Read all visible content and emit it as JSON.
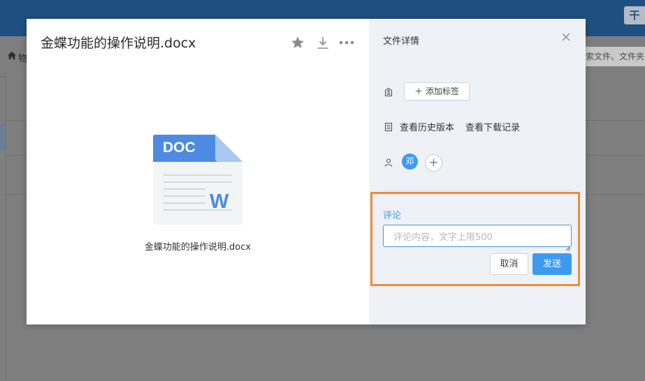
{
  "background": {
    "topbar_button": "干",
    "breadcrumb_text": "物",
    "search_placeholder": "索文件、文件夹"
  },
  "preview": {
    "file_name": "金蝶功能的操作说明.docx",
    "file_caption": "金蝶功能的操作说明.docx",
    "icon_type_text": "DOC",
    "icon_app_letter": "W",
    "toolbar_icons": [
      "star-icon",
      "download-icon",
      "more-icon"
    ]
  },
  "details": {
    "title": "文件详情",
    "add_tag_label": "＋ 添加标签",
    "history_link": "查看历史版本",
    "download_record_link": "查看下载记录",
    "member_avatar": "邓",
    "add_member_label": "+"
  },
  "comment": {
    "label": "评论",
    "placeholder": "评论内容，文字上限500",
    "value": "",
    "cancel_label": "取消",
    "send_label": "发送"
  },
  "colors": {
    "accent": "#3d9af1",
    "highlight_border": "#ef8b3a",
    "doc_icon_blue": "#4d8be2",
    "app_topbar": "#1f4f80"
  }
}
